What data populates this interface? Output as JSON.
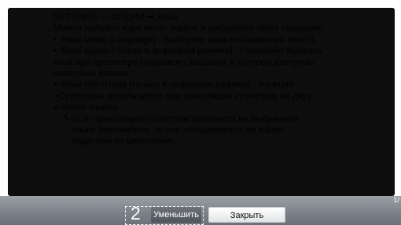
{
  "help": {
    "breadcrumb": "SETTINGS ⇨ ОПЦИИ ➡ Язык",
    "intro": "Можно выбрать язык меню экрана и цифрового звука передачи.",
    "items": [
      {
        "bullet": "•",
        "lines": [
          "Язык меню (Language) : Выберите язык отображения текста."
        ]
      },
      {
        "bullet": "•",
        "lines": [
          "Язык аудио [только в цифровом режиме] : Позволяет выбрать",
          "язык при просмотре цифрового вещания, в котором доступны",
          "несколько языков."
        ]
      },
      {
        "bullet": "•",
        "lines": [
          "Язык субтитров [только в цифровом режиме] : Функция",
          "«Субтитры» используется при трансляции субтитров на двух",
          "и более языках."
        ]
      }
    ],
    "note": {
      "icon": "✎",
      "lines": [
        "Если трансляция субтитров/телетекста на выбранном",
        "языке невозможна, то они отображаются на языке,",
        "заданном по умолчанию."
      ]
    }
  },
  "footer": {
    "page_indicator": "1/",
    "step_number": "2",
    "shrink_label": "Уменьшить",
    "close_label": "Закрыть"
  },
  "colors": {
    "panel_bg": "#0d0d0d",
    "text": "#f2f2f2",
    "bar": "#7d838a"
  }
}
